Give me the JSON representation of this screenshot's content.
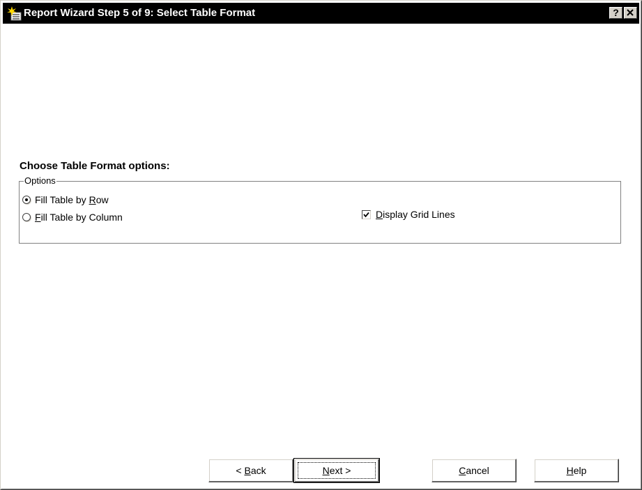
{
  "window": {
    "title": "Report Wizard Step 5 of 9: Select Table Format",
    "help_button": "?",
    "close_button": "✕"
  },
  "content": {
    "heading": "Choose Table Format options:",
    "group_label": "Options",
    "options": [
      {
        "pre": "Fill Table by ",
        "key": "R",
        "post": "ow",
        "checked": true
      },
      {
        "pre": "",
        "key": "F",
        "post": "ill Table by Column",
        "checked": false
      }
    ],
    "grid_lines": {
      "pre": "",
      "key": "D",
      "post": "isplay Grid Lines",
      "checked": true
    }
  },
  "buttons": {
    "back": {
      "pre": "< ",
      "key": "B",
      "post": "ack"
    },
    "next": {
      "pre": "",
      "key": "N",
      "post": "ext >"
    },
    "cancel": {
      "pre": "",
      "key": "C",
      "post": "ancel"
    },
    "help": {
      "pre": "",
      "key": "H",
      "post": "elp"
    }
  },
  "colors": {
    "titlebar_bg": "#000000",
    "titlebar_text": "#ffffff",
    "dialog_bg": "#ffffff",
    "icon_star": "#ffd700"
  }
}
